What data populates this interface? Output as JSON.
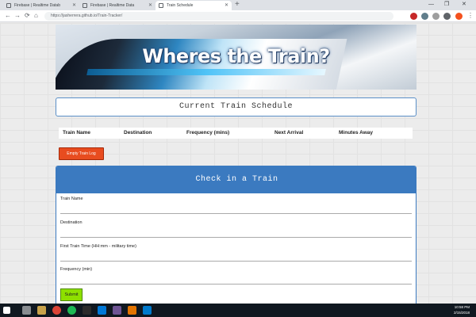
{
  "browser": {
    "tabs": [
      {
        "label": "Firebase | Realtime Datab"
      },
      {
        "label": "Firebase | Realtime Data"
      },
      {
        "label": "Train Schedule"
      }
    ],
    "new_tab": "+",
    "url": "https://jasherrera.github.io/Train-Tracker/",
    "window_controls": [
      "—",
      "❐",
      "✕"
    ]
  },
  "hero": {
    "title": "Wheres the Train?"
  },
  "schedule": {
    "title": "Current Train Schedule",
    "columns": [
      "Train Name",
      "Destination",
      "Frequency (mins)",
      "Next Arrival",
      "Minutes Away"
    ],
    "empty_button": "Empty Train Log"
  },
  "form": {
    "title": "Check in a Train",
    "fields": [
      {
        "label": "Train Name",
        "value": ""
      },
      {
        "label": "Destination",
        "value": ""
      },
      {
        "label": "First Train Time (HH:mm - military time)",
        "value": ""
      },
      {
        "label": "Frequency (min)",
        "value": ""
      }
    ],
    "submit": "Submit"
  },
  "taskbar": {
    "clock_time": "10:58 PM",
    "clock_date": "2/15/2018"
  },
  "colors": {
    "accent": "#3b7ac0",
    "danger": "#e84c1f",
    "submit": "#8ee000"
  }
}
